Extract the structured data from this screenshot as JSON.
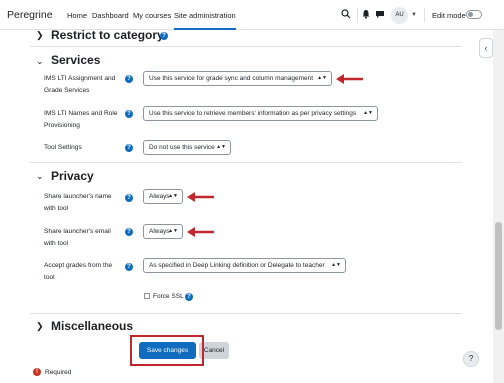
{
  "navbar": {
    "brand": "Peregrine",
    "links": [
      "Home",
      "Dashboard",
      "My courses",
      "Site administration"
    ],
    "avatar_initials": "AU",
    "edit_mode_label": "Edit mode"
  },
  "sections": {
    "restrict": {
      "title": "Restrict to category",
      "icon": "chevron-right-icon"
    },
    "services": {
      "title": "Services",
      "icon": "chevron-down-icon"
    },
    "privacy": {
      "title": "Privacy",
      "icon": "chevron-down-icon"
    },
    "misc": {
      "title": "Miscellaneous",
      "icon": "chevron-right-icon"
    }
  },
  "services": {
    "ags_label": "IMS LTI Assignment and Grade Services",
    "ags_value": "Use this service for grade sync and column management",
    "nrps_label": "IMS LTI Names and Role Provisioning",
    "nrps_value": "Use this service to retrieve members' information as per privacy settings",
    "toolsettings_label": "Tool Settings",
    "toolsettings_value": "Do not use this service"
  },
  "privacy": {
    "share_name_label": "Share launcher's name with tool",
    "share_name_value": "Always",
    "share_email_label": "Share launcher's email with tool",
    "share_email_value": "Always",
    "accept_grades_label": "Accept grades from the tool",
    "accept_grades_value": "As specified in Deep Linking definition or Delegate to teacher",
    "force_ssl_label": "Force SSL"
  },
  "buttons": {
    "save": "Save changes",
    "cancel": "Cancel"
  },
  "required_label": "Required",
  "colors": {
    "primary": "#0f6cbf",
    "annotation": "#c0282d",
    "required": "#ca3120"
  }
}
